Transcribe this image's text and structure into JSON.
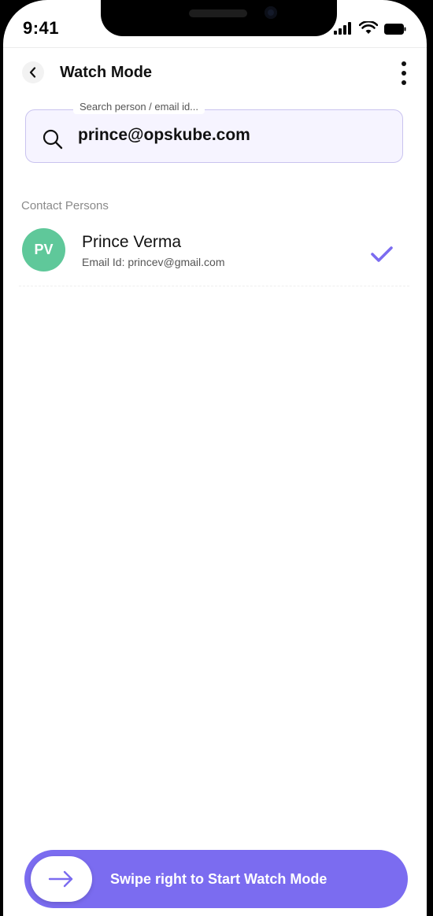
{
  "status_bar": {
    "time": "9:41"
  },
  "header": {
    "title": "Watch Mode"
  },
  "search": {
    "placeholder": "Search person / email id...",
    "value": "prince@opskube.com"
  },
  "contacts": {
    "section_title": "Contact Persons",
    "items": [
      {
        "initials": "PV",
        "name": "Prince Verma",
        "email": "Email Id: princev@gmail.com",
        "selected": true
      }
    ]
  },
  "swipe": {
    "label": "Swipe right to Start Watch Mode"
  },
  "colors": {
    "accent": "#7b6cf0",
    "avatar": "#5fc89a",
    "search_bg": "#f6f4ff"
  }
}
